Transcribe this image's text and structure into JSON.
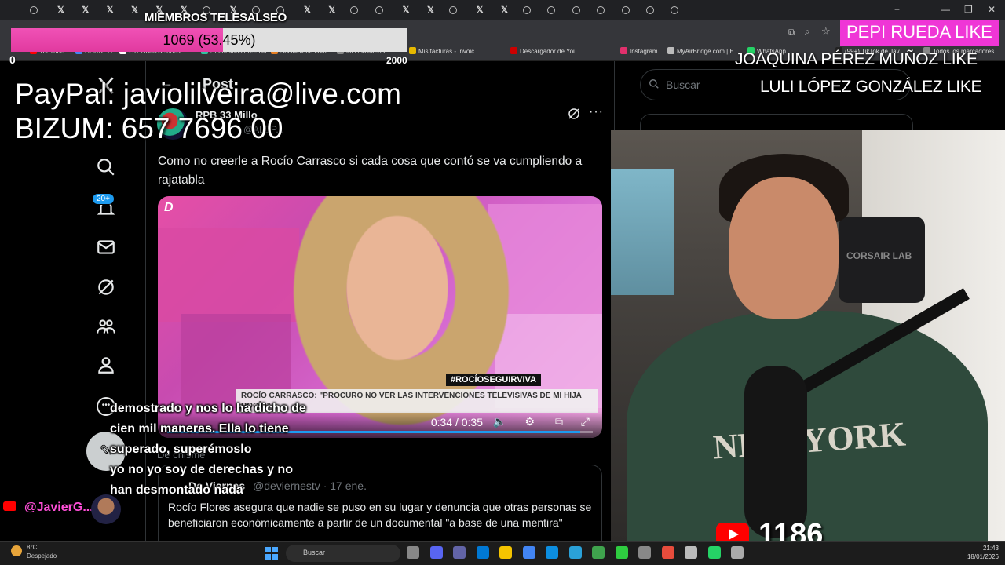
{
  "browser": {
    "bookmarks": [
      {
        "label": "YouTube",
        "color": "#ff0000"
      },
      {
        "label": "CORREO",
        "color": "#4285f4"
      },
      {
        "label": "20+ Notificaciones",
        "color": "#ffffff"
      },
      {
        "label": "Streamlabs Free Dri...",
        "color": "#31c3a2"
      },
      {
        "label": "Socialblade.com",
        "color": "#e67e22"
      },
      {
        "label": "Mi Chavalería",
        "color": "#888888"
      },
      {
        "label": "Mis facturas - Invoic...",
        "color": "#e6b800"
      },
      {
        "label": "Descargador de You...",
        "color": "#cc0000"
      },
      {
        "label": "Instagram",
        "color": "#e1306c"
      },
      {
        "label": "MyAirBridge.com | E...",
        "color": "#bbbbbb"
      },
      {
        "label": "WhatsApp",
        "color": "#25d366"
      },
      {
        "label": "(99+) TikTok de Jav...",
        "color": "#222222"
      },
      {
        "label": "Todos los marcadores",
        "color": "#888888"
      }
    ]
  },
  "overlay": {
    "members_title": "MIEMBROS TELESALSEO",
    "goal_text": "1069 (53.45%)",
    "goal_fraction": 0.5345,
    "goal_min": "0",
    "goal_max": "2000",
    "paypal": "PayPal: javiolilveira@live.com",
    "bizum": "BIZUM: 657 7696 00",
    "likes": [
      "PEPI RUEDA  LIKE",
      "JOAQUINA PÉREZ MUÑOZ  LIKE",
      "LULI LÓPEZ GONZÁLEZ  LIKE"
    ],
    "youtube_viewers": "1186",
    "chat_text": "demostrado y nos lo ha dicho de cien mil maneras. Ella lo tiene superado, superémoslo",
    "chat_text2": "yo no yo soy de derechas y no han desmontado nada",
    "chat_user": "@JavierG..."
  },
  "x": {
    "page_title": "Post",
    "back": "←",
    "notifications_badge": "20+",
    "author": "RPB 33 Millo",
    "handle": "@ALEP...",
    "tweet_text": "Como no creerle a Rocío Carrasco si cada cosa que contó se va cumpliendo a rajatabla",
    "video": {
      "channel_logo": "D",
      "hashtag": "#ROCÍOSEGUIRVIVA",
      "lower_third": "ROCÍO CARRASCO: \"PROCURO NO VER LAS INTERVENCIONES TELEVISIVAS DE MI HIJA ROCÍO\"",
      "time": "0:34 / 0:35",
      "progress": 0.97
    },
    "reply_label": "De chisme",
    "card2_author": "De Viernes",
    "card2_handle": "@deviernestv · 17 ene.",
    "card2_text": "Rocío Flores asegura que nadie se puso en su lugar y denuncia que otras personas se beneficiaron económicamente a partir de un documental \"a base de una mentira\"",
    "search_placeholder": "Buscar"
  },
  "webcam": {
    "shirt_text": "NEW YORK",
    "chair_text": "CORSAIR LAB"
  },
  "taskbar": {
    "weather_temp": "8°C",
    "weather_desc": "Despejado",
    "search": "Buscar",
    "time": "21:43",
    "date": "18/01/2026"
  }
}
